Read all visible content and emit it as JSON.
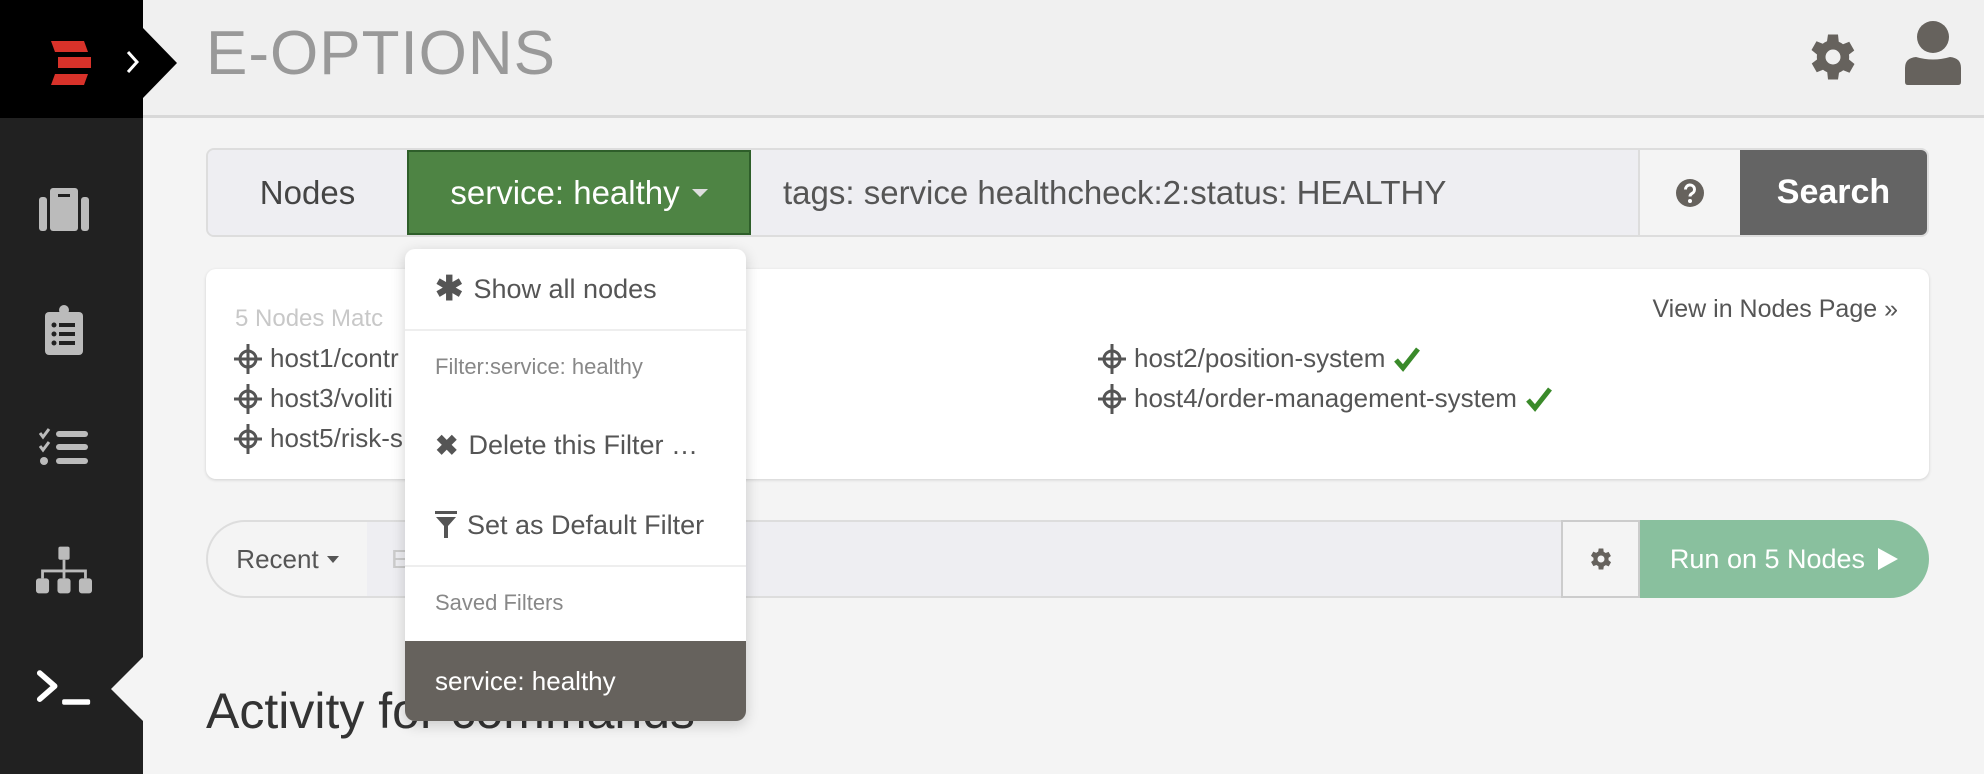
{
  "app": {
    "title": "E-OPTIONS"
  },
  "sidebar": {
    "items": [
      {
        "icon": "briefcase-icon",
        "label": "Projects"
      },
      {
        "icon": "clipboard-list-icon",
        "label": "Jobs"
      },
      {
        "icon": "tasks-icon",
        "label": "Activity"
      },
      {
        "icon": "sitemap-icon",
        "label": "Nodes"
      },
      {
        "icon": "terminal-icon",
        "label": "Commands",
        "active": true
      }
    ]
  },
  "search": {
    "nodes_label": "Nodes",
    "filter_label": "service: healthy",
    "query": "tags: service healthcheck:2:status: HEALTHY",
    "search_label": "Search"
  },
  "nodes": {
    "match_text": "5 Nodes Matc",
    "view_link": "View in Nodes Page »",
    "left": [
      "host1/contr",
      "host3/voliti",
      "host5/risk-s"
    ],
    "right": [
      "host2/position-system",
      "host4/order-management-system"
    ]
  },
  "dropdown": {
    "show_all": "Show all nodes",
    "filter_header": "Filter:service: healthy",
    "delete": "Delete this Filter …",
    "set_default": "Set as Default Filter",
    "saved_header": "Saved Filters",
    "saved": [
      "service: healthy"
    ]
  },
  "command": {
    "recent_label": "Recent",
    "placeholder": "E",
    "run_label": "Run on 5 Nodes"
  },
  "activity": {
    "heading": "Activity for commands"
  },
  "colors": {
    "filter_green": "#4e8444",
    "run_green": "#89c09e",
    "check_green": "#3a8a2a",
    "selected": "#66625d"
  }
}
